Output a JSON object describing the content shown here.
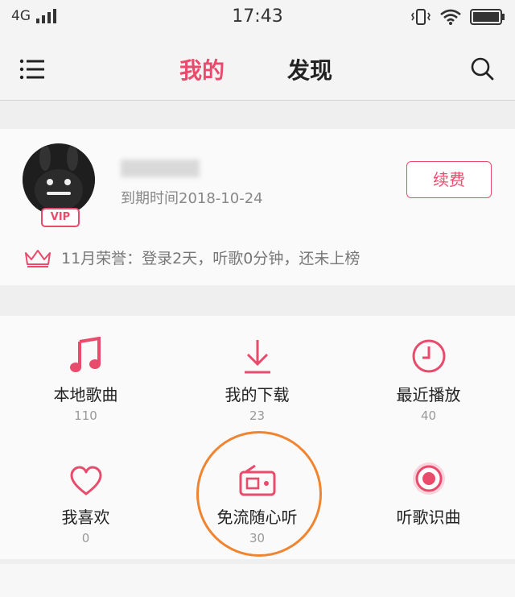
{
  "statusbar": {
    "network": "4G",
    "time": "17:43"
  },
  "navbar": {
    "tab_mine": "我的",
    "tab_discover": "发现"
  },
  "profile": {
    "username": "",
    "vip_badge": "VIP",
    "expiry": "到期时间2018-10-24",
    "renew_button": "续费",
    "honor_text": "11月荣誉：登录2天，听歌0分钟，还未上榜"
  },
  "grid": {
    "items": [
      {
        "label": "本地歌曲",
        "count": "110",
        "icon": "music-note-icon"
      },
      {
        "label": "我的下载",
        "count": "23",
        "icon": "download-icon"
      },
      {
        "label": "最近播放",
        "count": "40",
        "icon": "clock-icon"
      },
      {
        "label": "我喜欢",
        "count": "0",
        "icon": "heart-icon"
      },
      {
        "label": "免流随心听",
        "count": "30",
        "icon": "radio-icon"
      },
      {
        "label": "听歌识曲",
        "count": "",
        "icon": "record-icon"
      }
    ]
  },
  "colors": {
    "accent": "#e94b6c",
    "highlight": "#ef8431"
  }
}
